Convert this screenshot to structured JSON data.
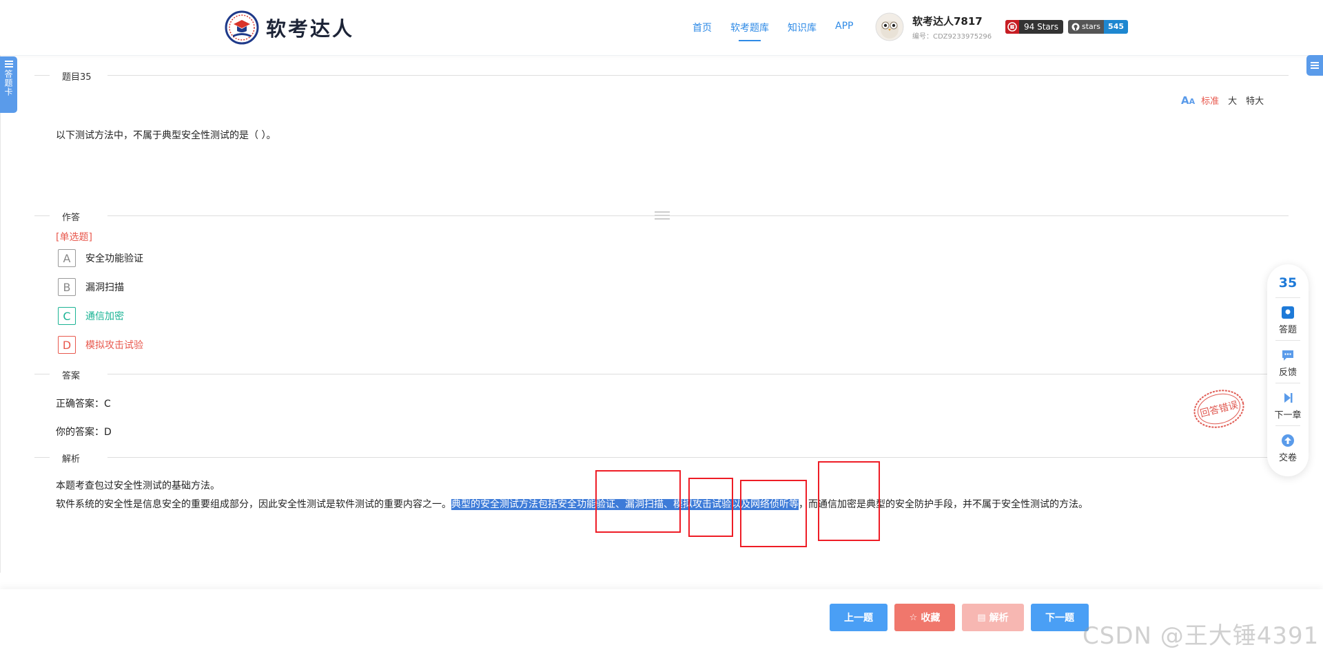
{
  "header": {
    "logo_text": "软考达人",
    "nav": [
      "首页",
      "软考题库",
      "知识库",
      "APP"
    ],
    "active_nav": "软考题库",
    "user_name": "软考达人7817",
    "user_id": "编号：CDZ9233975296",
    "gitee_badge": "94 Stars",
    "github_label": "stars",
    "github_count": "545"
  },
  "side": {
    "left_tab": "答题卡"
  },
  "question": {
    "title": "题目35",
    "font_options": [
      "标准",
      "大",
      "特大"
    ],
    "active_font": "标准",
    "text": "以下测试方法中，不属于典型安全性测试的是（ ）。"
  },
  "answer_section": {
    "title": "作答",
    "type_label": "[单选题]",
    "options": [
      {
        "letter": "A",
        "text": "安全功能验证"
      },
      {
        "letter": "B",
        "text": "漏洞扫描"
      },
      {
        "letter": "C",
        "text": "通信加密"
      },
      {
        "letter": "D",
        "text": "模拟攻击试验"
      }
    ],
    "correct_letter": "C",
    "chosen_letter": "D"
  },
  "result_section": {
    "title": "答案",
    "correct_answer": "正确答案：C",
    "your_answer": "你的答案：D",
    "stamp_text": "回答错误"
  },
  "explanation": {
    "title": "解析",
    "line1": "本题考查包过安全性测试的基础方法。",
    "line2_before": "软件系统的安全性是信息安全的重要组成部分，因此安全性测试是软件测试的重要内容之一。",
    "line2_highlight": "典型的安全测试方法包括安全功能验证、漏洞扫描、模拟攻击试验以及网络侦听等",
    "line2_after": "，而通信加密是典型的安全防护手段，并不属于安全性测试的方法。"
  },
  "toolbar": {
    "number": "35",
    "items": [
      "答题",
      "反馈",
      "下一章",
      "交卷"
    ]
  },
  "buttons": {
    "prev": "上一题",
    "favorite": "收藏",
    "analysis": "解析",
    "next": "下一题"
  },
  "watermark": "CSDN @王大锤4391",
  "colors": {
    "accent": "#2e8ae6",
    "correct": "#1ab394",
    "wrong": "#e8584d",
    "highlight": "#3d7bd8",
    "annotation": "#ee1c25"
  }
}
